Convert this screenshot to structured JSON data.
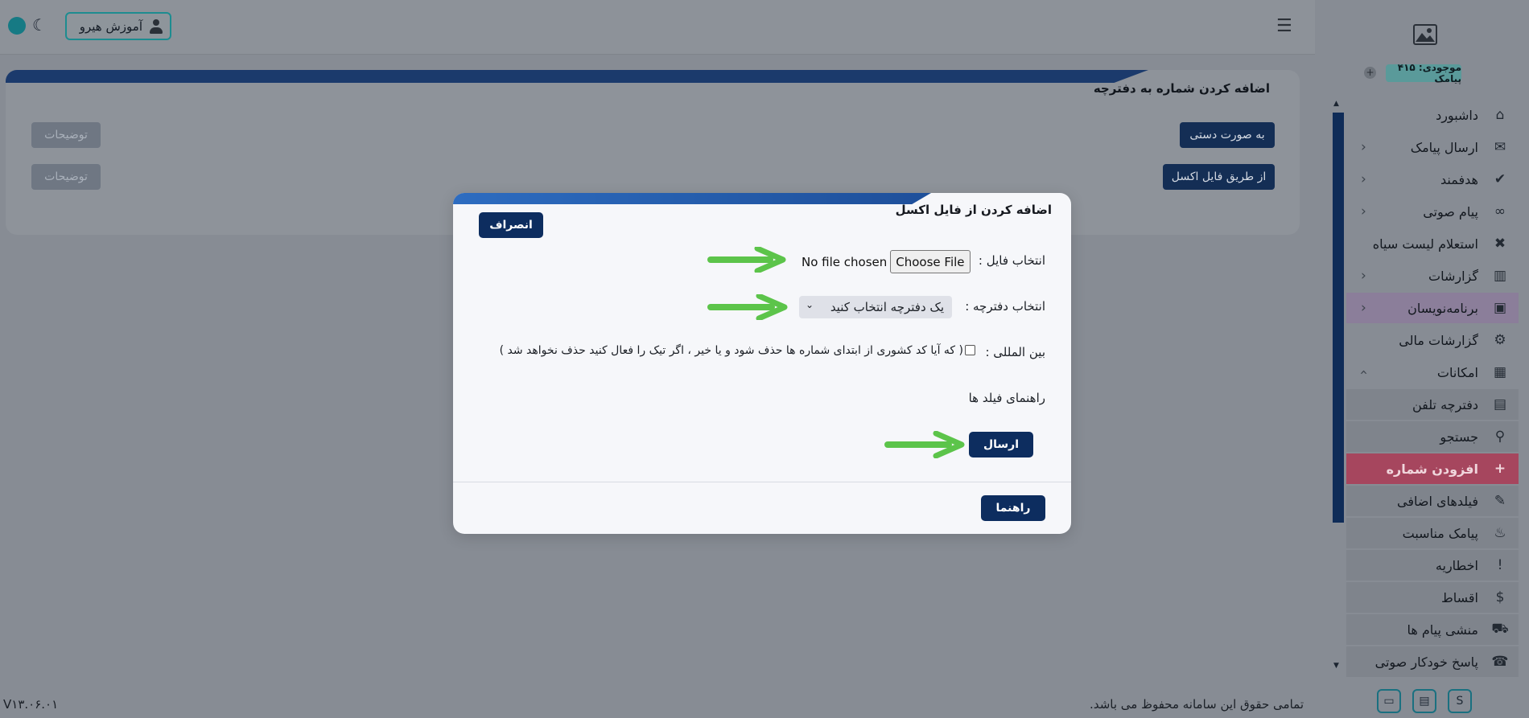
{
  "topbar": {
    "hero_button_label": "آموزش هیرو"
  },
  "card": {
    "title": "اضافه کردن شماره به دفترچه",
    "manual_button": "به صورت دستی",
    "excel_button": "از طریق فایل اکسل",
    "desc_button_1": "توضیحات",
    "desc_button_2": "توضیحات"
  },
  "sidebar": {
    "balance": "موجودی: ۴۱۵ پیامک",
    "items": [
      {
        "label": "داشبورد",
        "icon": "home-icon"
      },
      {
        "label": "ارسال پیامک",
        "icon": "sms-icon"
      },
      {
        "label": "هدفمند",
        "icon": "target-message-icon"
      },
      {
        "label": "پیام صوتی",
        "icon": "voicemail-icon"
      },
      {
        "label": "استعلام لیست سیاه",
        "icon": "blacklist-icon"
      },
      {
        "label": "گزارشات",
        "icon": "reports-icon"
      },
      {
        "label": "برنامه‌نویسان",
        "icon": "developers-icon"
      },
      {
        "label": "گزارشات مالی",
        "icon": "financial-reports-icon"
      },
      {
        "label": "امکانات",
        "icon": "features-icon"
      },
      {
        "label": "دفترچه تلفن",
        "icon": "phonebook-icon"
      },
      {
        "label": "جستجو",
        "icon": "user-search-icon"
      },
      {
        "label": "افزودن شماره",
        "icon": "add-user-icon"
      },
      {
        "label": "فیلدهای اضافی",
        "icon": "edit-fields-icon"
      },
      {
        "label": "پیامک مناسبت",
        "icon": "cake-icon"
      },
      {
        "label": "اخطاریه",
        "icon": "alert-icon"
      },
      {
        "label": "اقساط",
        "icon": "installments-icon"
      },
      {
        "label": "منشی پیام ها",
        "icon": "message-secretary-icon"
      },
      {
        "label": "پاسخ خودکار صوتی",
        "icon": "auto-voice-reply-icon"
      }
    ]
  },
  "modal": {
    "title": "اضافه کردن از فایل اکسل",
    "cancel_button": "انصراف",
    "file_label": "انتخاب فایل :",
    "file_button": "Choose File",
    "file_status": "No file chosen",
    "phonebook_label": "انتخاب دفترچه :",
    "phonebook_select_value": "یک دفترچه انتخاب کنید",
    "international_label": "بین المللی :",
    "international_hint": "( که آیا کد کشوری از ابتدای شماره ها حذف شود و یا خیر ، اگر تیک را فعال کنید حذف نخواهد شد )",
    "fields_guide": "راهنمای فیلد ها",
    "send_button": "ارسال",
    "guide_button": "راهنما"
  },
  "footer": {
    "copyright": "تمامی حقوق این سامانه محفوظ می باشد.",
    "version": "V۱۳.۰۶.۰۱"
  },
  "colors": {
    "primary": "#0d2d5f",
    "accent_teal": "#1d8c90",
    "current_item": "#a6465e",
    "arrow": "#5cc44a"
  }
}
